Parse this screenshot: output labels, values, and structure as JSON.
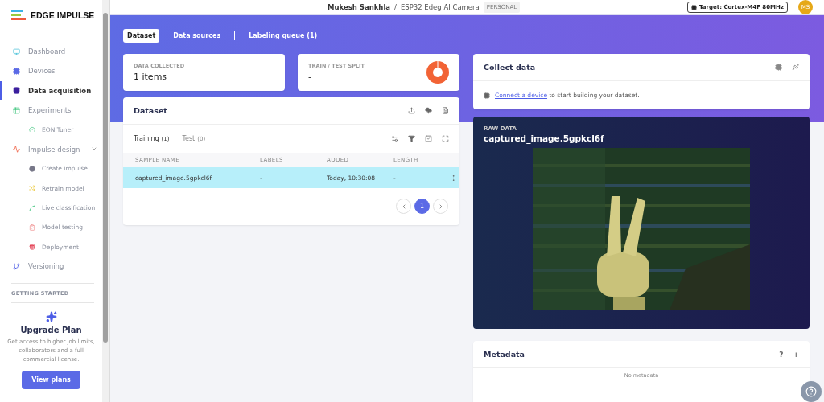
{
  "brand": {
    "name": "EDGE IMPULSE"
  },
  "sidebar": {
    "items": [
      {
        "label": "Dashboard",
        "selected": false
      },
      {
        "label": "Devices",
        "selected": false
      },
      {
        "label": "Data acquisition",
        "selected": true
      },
      {
        "label": "Experiments",
        "selected": false,
        "children": [
          {
            "label": "EON Tuner",
            "selected": false
          }
        ]
      },
      {
        "label": "Impulse design",
        "selected": false,
        "expanded": true,
        "children": [
          {
            "label": "Create impulse",
            "selected": false
          },
          {
            "label": "Retrain model",
            "selected": false
          },
          {
            "label": "Live classification",
            "selected": false
          },
          {
            "label": "Model testing",
            "selected": false
          },
          {
            "label": "Deployment",
            "selected": false
          }
        ]
      },
      {
        "label": "Versioning",
        "selected": false
      }
    ],
    "section": "GETTING STARTED",
    "upgrade": {
      "title": "Upgrade Plan",
      "text": "Get access to higher job limits, collaborators and a full commercial license.",
      "button": "View plans"
    }
  },
  "header": {
    "user": "Mukesh Sankhla",
    "separator": "/",
    "project": "ESP32 Edeg AI Camera",
    "badge": "PERSONAL",
    "target": "Target: Cortex-M4F 80MHz",
    "avatar": "MS"
  },
  "tabs": [
    {
      "label": "Dataset",
      "selected": true
    },
    {
      "label": "Data sources",
      "selected": false
    },
    {
      "label": "Labeling queue (1)",
      "selected": false
    }
  ],
  "stats": [
    {
      "label": "DATA COLLECTED",
      "value": "1 items"
    },
    {
      "label": "TRAIN / TEST SPLIT",
      "value": "-"
    }
  ],
  "dataset": {
    "title": "Dataset",
    "subtabs": [
      {
        "label": "Training",
        "count": "(1)",
        "selected": true
      },
      {
        "label": "Test",
        "count": "(0)",
        "selected": false
      }
    ],
    "columns": [
      "SAMPLE NAME",
      "LABELS",
      "ADDED",
      "LENGTH"
    ],
    "rows": [
      {
        "cells": [
          "captured_image.5gpkcl6f",
          "-",
          "Today, 10:30:08",
          "-"
        ],
        "selected": true
      }
    ],
    "pages": [
      {
        "label": "1",
        "selected": true
      }
    ]
  },
  "collect": {
    "title": "Collect data",
    "link": "Connect a device",
    "text": " to start building your dataset."
  },
  "raw": {
    "label": "RAW DATA",
    "title": "captured_image.5gpkcl6f"
  },
  "metadata": {
    "title": "Metadata",
    "help": "?",
    "add": "+",
    "empty": "No metadata"
  }
}
